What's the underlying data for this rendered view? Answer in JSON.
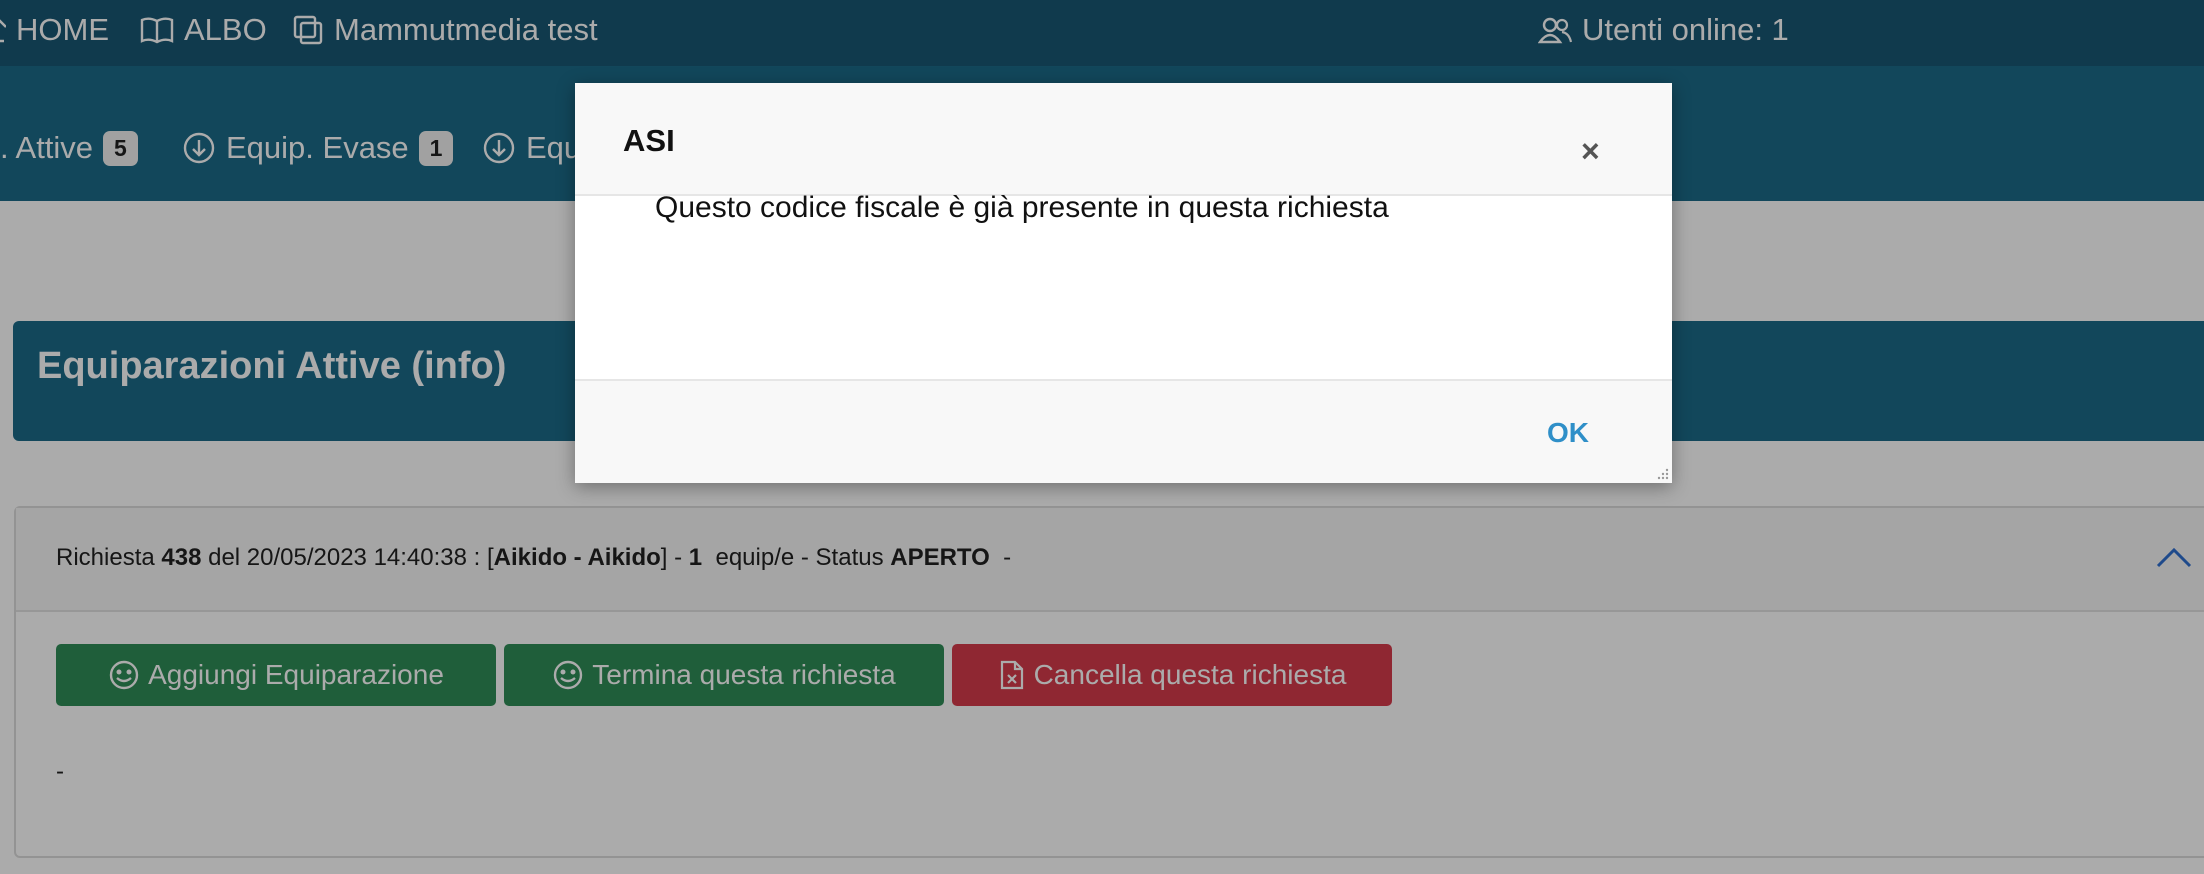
{
  "topbar": {
    "home_label": "HOME",
    "albo_label": "ALBO",
    "org_label": "Mammutmedia test",
    "users_online_label": "Utenti online: 1"
  },
  "tabs": [
    {
      "label": ". Attive",
      "badge": "5"
    },
    {
      "label": "Equip. Evase",
      "badge": "1"
    },
    {
      "label": "Equ"
    }
  ],
  "panel": {
    "title": "Equiparazioni Attive (info)"
  },
  "request": {
    "prefix": "Richiesta ",
    "number": "438",
    "date_text": " del 20/05/2023 14:40:38 : [",
    "discipline": "Aikido - Aikido",
    "mid_text": "] - ",
    "count": "1",
    "status_text": "  equip/e - Status ",
    "status": "APERTO",
    "suffix": "  -",
    "buttons": {
      "add": "Aggiungi Equiparazione",
      "finish": "Termina questa richiesta",
      "cancel": "Cancella questa richiesta"
    },
    "note": "-"
  },
  "modal": {
    "title": "ASI",
    "close_symbol": "×",
    "message": "Questo codice fiscale è già presente in questa richiesta",
    "ok_label": "OK"
  },
  "colors": {
    "nav_dark": "#195773",
    "nav": "#1b6a88",
    "green": "#2f8c57",
    "red": "#d63b4b",
    "link_blue": "#2f8fc8"
  }
}
